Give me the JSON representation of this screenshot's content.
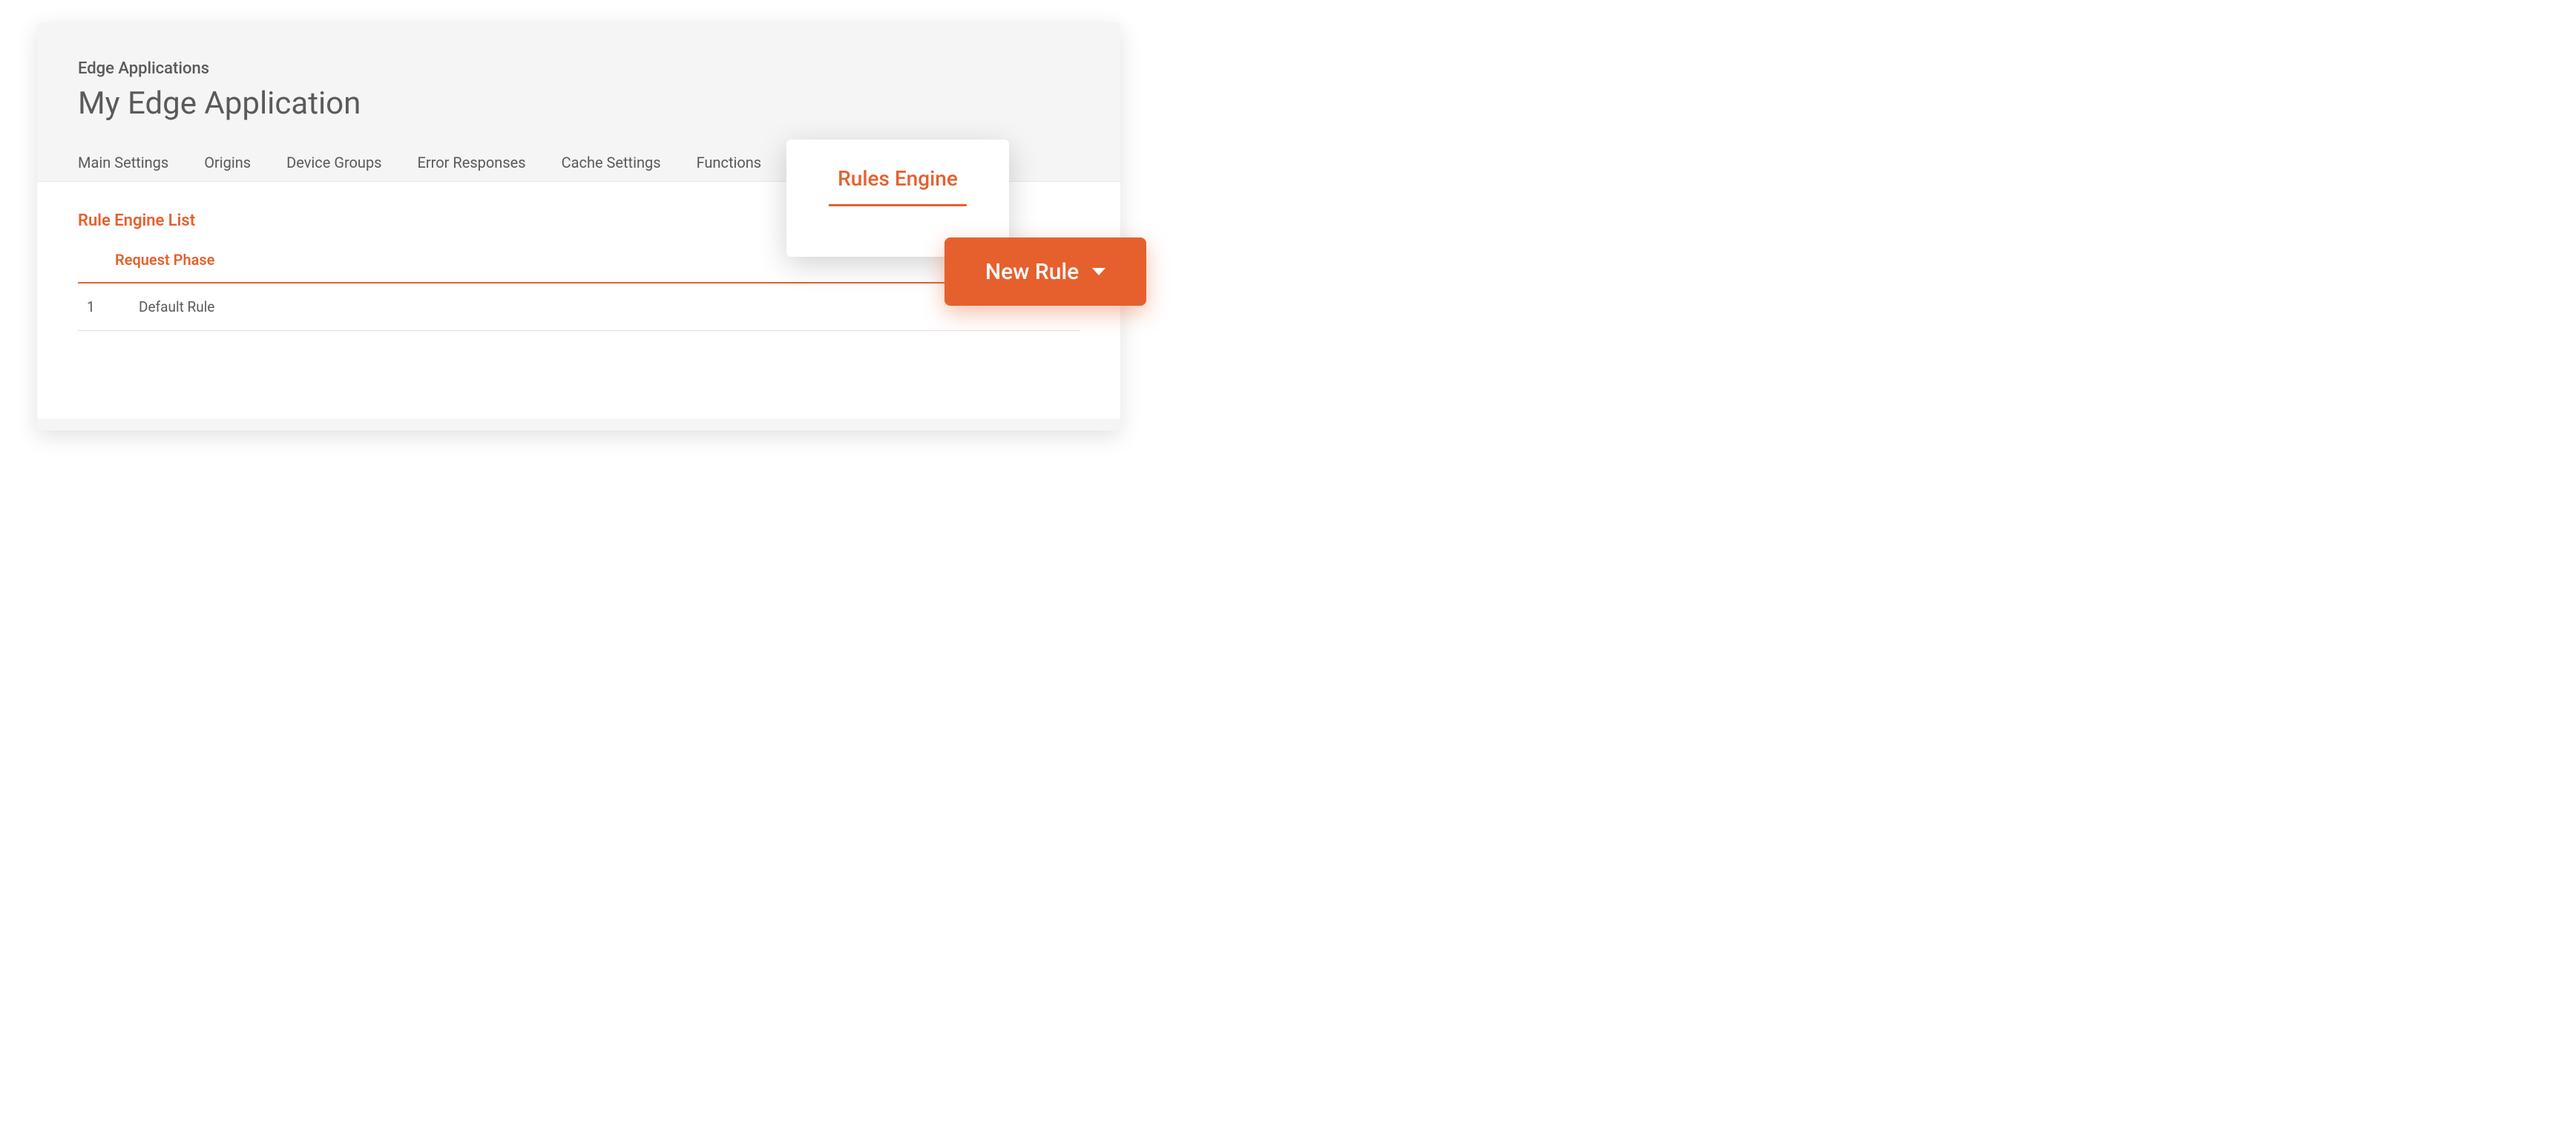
{
  "breadcrumb": "Edge Applications",
  "page_title": "My Edge Application",
  "tabs": [
    {
      "label": "Main Settings"
    },
    {
      "label": "Origins"
    },
    {
      "label": "Device Groups"
    },
    {
      "label": "Error Responses"
    },
    {
      "label": "Cache Settings"
    },
    {
      "label": "Functions"
    }
  ],
  "active_tab": {
    "label": "Rules Engine"
  },
  "section": {
    "title": "Rule Engine List",
    "phase_label": "Request Phase"
  },
  "rows": [
    {
      "index": "1",
      "name": "Default Rule"
    }
  ],
  "new_rule_button": {
    "label": "New Rule"
  },
  "colors": {
    "accent": "#e6602e",
    "text": "#5a5a5a"
  }
}
